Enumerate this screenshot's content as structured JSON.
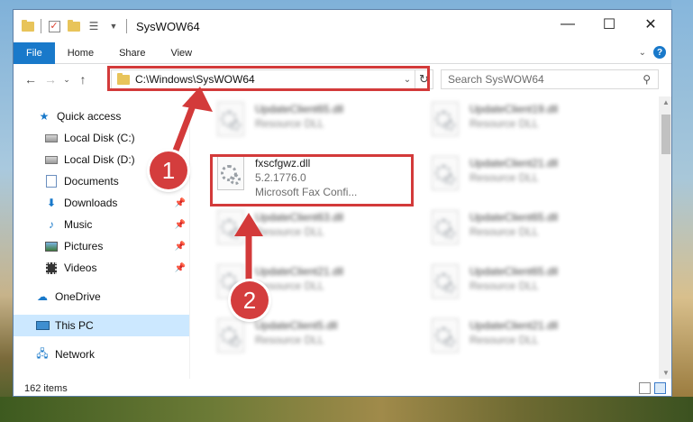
{
  "window": {
    "title": "SysWOW64",
    "controls": {
      "minimize": "—",
      "maximize": "☐",
      "close": "✕"
    }
  },
  "ribbon": {
    "tabs": [
      "File",
      "Home",
      "Share",
      "View"
    ],
    "expand_icon": "chevron-down-icon",
    "help_label": "?"
  },
  "navigation": {
    "back_icon": "back-arrow-icon",
    "forward_icon": "forward-arrow-icon",
    "recent_icon": "chevron-down-icon",
    "up_icon": "up-arrow-icon",
    "address_path": "C:\\Windows\\SysWOW64",
    "search_placeholder": "Search SysWOW64"
  },
  "sidebar": {
    "items": [
      {
        "label": "Quick access",
        "icon": "star-icon",
        "pinned": false
      },
      {
        "label": "Local Disk (C:)",
        "icon": "disk-icon",
        "pinned": false
      },
      {
        "label": "Local Disk (D:)",
        "icon": "disk-icon",
        "pinned": false
      },
      {
        "label": "Documents",
        "icon": "documents-icon",
        "pinned": false
      },
      {
        "label": "Downloads",
        "icon": "downloads-icon",
        "pinned": true
      },
      {
        "label": "Music",
        "icon": "music-icon",
        "pinned": true
      },
      {
        "label": "Pictures",
        "icon": "pictures-icon",
        "pinned": true
      },
      {
        "label": "Videos",
        "icon": "videos-icon",
        "pinned": true
      },
      {
        "label": "OneDrive",
        "icon": "onedrive-icon",
        "pinned": false
      },
      {
        "label": "This PC",
        "icon": "this-pc-icon",
        "pinned": false,
        "selected": true
      },
      {
        "label": "Network",
        "icon": "network-icon",
        "pinned": false
      }
    ]
  },
  "files": {
    "highlighted": {
      "name": "fxscfgwz.dll",
      "version": "5.2.1776.0",
      "description": "Microsoft Fax Confi..."
    },
    "left_column": [
      {
        "name": "UpdateClient65.dll",
        "type": "Resource DLL"
      },
      {
        "name": "UpdateClient63.dll",
        "type": "Resource DLL"
      },
      {
        "name": "UpdateClient21.dll",
        "type": "Resource DLL"
      },
      {
        "name": "UpdateClient5.dll",
        "type": "Resource DLL"
      }
    ],
    "right_column": [
      {
        "name": "UpdateClient19.dll",
        "type": "Resource DLL"
      },
      {
        "name": "UpdateClient21.dll",
        "type": "Resource DLL"
      },
      {
        "name": "UpdateClient65.dll",
        "type": "Resource DLL"
      },
      {
        "name": "UpdateClient65.dll",
        "type": "Resource DLL"
      },
      {
        "name": "UpdateClient21.dll",
        "type": "Resource DLL"
      }
    ]
  },
  "status": {
    "item_count": "162 items"
  },
  "annotations": {
    "step1": "1",
    "step2": "2",
    "color": "#d33a3a"
  }
}
